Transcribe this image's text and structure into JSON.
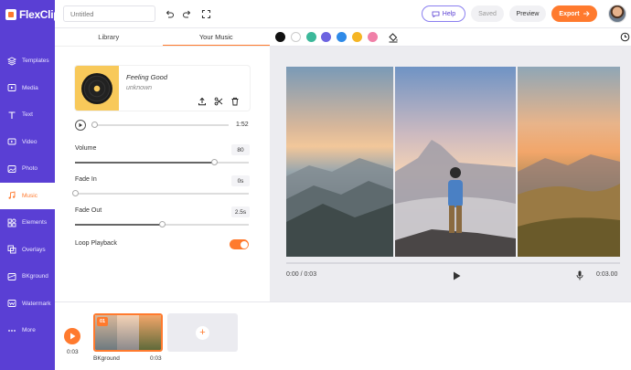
{
  "app": {
    "name": "FlexClip"
  },
  "sidebar": {
    "items": [
      {
        "label": "Templates",
        "icon": "templates-icon"
      },
      {
        "label": "Media",
        "icon": "media-icon"
      },
      {
        "label": "Text",
        "icon": "text-icon"
      },
      {
        "label": "Video",
        "icon": "video-icon"
      },
      {
        "label": "Photo",
        "icon": "photo-icon"
      },
      {
        "label": "Music",
        "icon": "music-icon",
        "active": true
      },
      {
        "label": "Elements",
        "icon": "elements-icon"
      },
      {
        "label": "Overlays",
        "icon": "overlays-icon"
      },
      {
        "label": "BKground",
        "icon": "background-icon"
      },
      {
        "label": "Watermark",
        "icon": "watermark-icon"
      },
      {
        "label": "More",
        "icon": "more-icon"
      }
    ]
  },
  "topbar": {
    "title_placeholder": "Untitled",
    "help_label": "Help",
    "saved_label": "Saved",
    "preview_label": "Preview",
    "export_label": "Export"
  },
  "panel": {
    "tabs": [
      {
        "label": "Library"
      },
      {
        "label": "Your Music",
        "active": true
      }
    ],
    "song": {
      "title": "Feeling Good",
      "artist": "unknown"
    },
    "duration": "1:52",
    "volume": {
      "label": "Volume",
      "value": "80",
      "level": 0.8
    },
    "fade_in": {
      "label": "Fade In",
      "value": "0s",
      "level": 0
    },
    "fade_out": {
      "label": "Fade Out",
      "value": "2.5s",
      "level": 0.5
    },
    "loop": {
      "label": "Loop Playback",
      "on": true
    }
  },
  "colors": {
    "accent": "#ff7a2e",
    "brand": "#5a3fd4",
    "swatches": [
      "#111111",
      "#ffffff",
      "#3cb89a",
      "#6c63e0",
      "#2f8ae8",
      "#f5b524",
      "#f080a8"
    ]
  },
  "player": {
    "current": "0:00 / 0:03",
    "total": "0:03.00"
  },
  "timeline": {
    "time": "0:03",
    "clip": {
      "badge": "01",
      "name": "BKground",
      "duration": "0:03"
    }
  }
}
